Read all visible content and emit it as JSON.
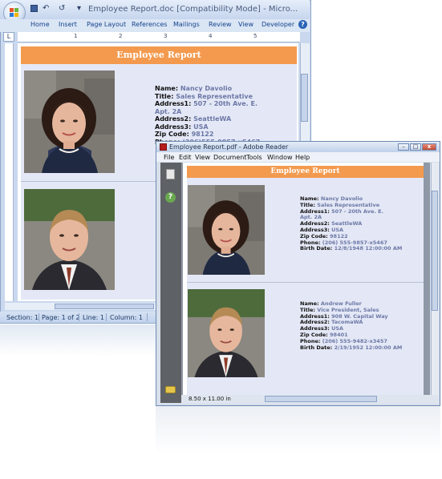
{
  "word": {
    "title": "Employee Report.doc [Compatibility Mode] - Micro...",
    "qat": {
      "undo": "↶",
      "redo": "↺",
      "more": "▾"
    },
    "tabs": [
      "Home",
      "Insert",
      "Page Layout",
      "References",
      "Mailings",
      "Review",
      "View",
      "Developer"
    ],
    "help": "?",
    "ruler_marks": [
      "1",
      "2",
      "3",
      "4",
      "5"
    ],
    "ruler_select": "L",
    "doc_header": "Employee Report",
    "records": [
      {
        "name_label": "Name:",
        "name": "Nancy Davolio",
        "title_label": "Title:",
        "title": "Sales Representative",
        "address1_label": "Address1:",
        "address1": "507 - 20th Ave. E.",
        "address1_cont": "Apt. 2A",
        "address2_label": "Address2:",
        "address2": "SeattleWA",
        "address3_label": "Address3:",
        "address3": "USA",
        "zip_label": "Zip Code:",
        "zip": "98122",
        "phone_label": "Phone:",
        "phone": "(206)555-9857-x5467"
      }
    ],
    "status": {
      "section": "Section: 1",
      "page": "Page: 1 of 2",
      "line": "Line: 1",
      "column": "Column: 1"
    }
  },
  "reader": {
    "title": "Employee Report.pdf - Adobe Reader",
    "window_buttons": {
      "minimize": "–",
      "maximize": "□",
      "close": "x"
    },
    "menu": [
      "File",
      "Edit",
      "View",
      "Document",
      "Tools",
      "Window",
      "Help"
    ],
    "help_glyph": "?",
    "doc_header": "Employee Report",
    "records": [
      {
        "name_label": "Name:",
        "name": "Nancy Davolio",
        "title_label": "Title:",
        "title": "Sales Representative",
        "address1_label": "Address1:",
        "address1": "507 - 20th Ave. E.",
        "address1_cont": "Apt. 2A",
        "address2_label": "Address2:",
        "address2": "SeattleWA",
        "address3_label": "Address3:",
        "address3": "USA",
        "zip_label": "Zip Code:",
        "zip": "98122",
        "phone_label": "Phone:",
        "phone": "(206) 555-9857-x5467",
        "birth_label": "Birth Date:",
        "birth": "12/8/1948 12:00:00 AM"
      },
      {
        "name_label": "Name:",
        "name": "Andrew Fuller",
        "title_label": "Title:",
        "title": "Vice President, Sales",
        "address1_label": "Address1:",
        "address1": "908 W. Capital Way",
        "address2_label": "Address2:",
        "address2": "TacomaWA",
        "address3_label": "Address3:",
        "address3": "USA",
        "zip_label": "Zip Code:",
        "zip": "98401",
        "phone_label": "Phone:",
        "phone": "(206) 555-9482-x3457",
        "birth_label": "Birth Date:",
        "birth": "2/19/1952 12:00:00 AM"
      }
    ],
    "page_size": "8.50 x 11.00 in"
  },
  "colors": {
    "report_header": "#f39a4f",
    "value_text": "#6c78a6",
    "report_background": "#e4e8f6"
  }
}
